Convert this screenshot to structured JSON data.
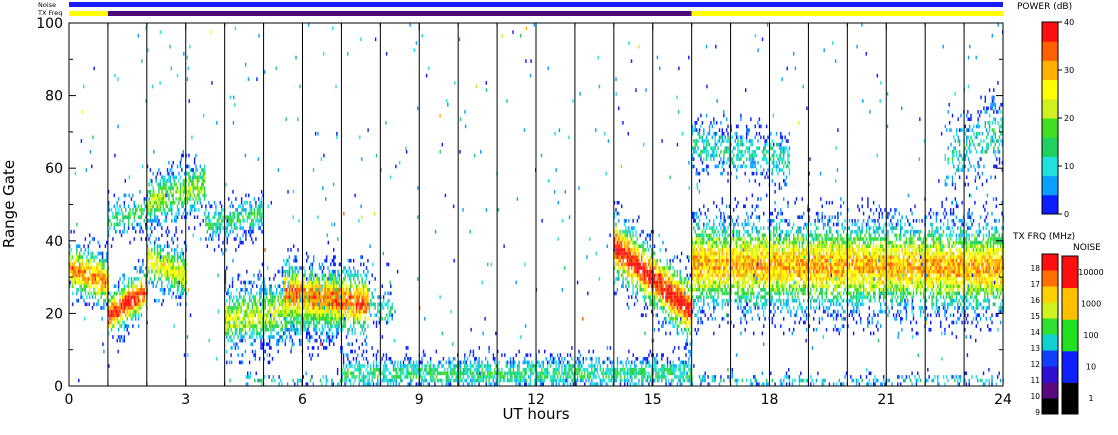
{
  "chart_data": {
    "type": "heatmap",
    "xlabel": "UT hours",
    "ylabel": "Range Gate",
    "xlim": [
      0,
      24
    ],
    "ylim": [
      0,
      100
    ],
    "xticks": [
      0,
      3,
      6,
      9,
      12,
      15,
      18,
      21,
      24
    ],
    "yticks": [
      0,
      20,
      40,
      60,
      80,
      100
    ],
    "scan_boundaries_ut": [
      1,
      2,
      3,
      4,
      5,
      6,
      7,
      8,
      9,
      10,
      11,
      12,
      13,
      14,
      15,
      16,
      17,
      18,
      19,
      20,
      21,
      22,
      23
    ],
    "status_bars": {
      "noise_label": "Noise",
      "txfreq_label": "TX Freq",
      "noise_color": "#1a1aff",
      "txfreq_segments": [
        {
          "start": 0,
          "end": 1,
          "color": "#ffff00"
        },
        {
          "start": 1,
          "end": 16,
          "color": "#4b0b7a"
        },
        {
          "start": 16,
          "end": 24,
          "color": "#ffff00"
        }
      ]
    },
    "power_scale": {
      "title": "POWER (dB)",
      "min": 0,
      "max": 40,
      "ticks": [
        0,
        10,
        20,
        30,
        40
      ],
      "colors": [
        "#0a1eff",
        "#0aa0ff",
        "#20e0e0",
        "#20d060",
        "#40e020",
        "#d0f020",
        "#ffff00",
        "#ffb000",
        "#ff6000",
        "#ff1010"
      ]
    },
    "txfreq_scale": {
      "title": "TX FRQ (MHz)",
      "ticks": [
        9,
        10,
        11,
        12,
        13,
        14,
        15,
        16,
        17,
        18
      ],
      "colors": [
        "#000000",
        "#5a0a80",
        "#3010d0",
        "#1040ff",
        "#10d0d0",
        "#30e030",
        "#d0f020",
        "#ffd000",
        "#ff7000",
        "#ff1010"
      ]
    },
    "noise_scale": {
      "title": "NOISE",
      "ticks": [
        "1",
        "10",
        "100",
        "1000",
        "10000"
      ],
      "colors": [
        "#000000",
        "#1020ff",
        "#20e020",
        "#ffc000",
        "#ff1010"
      ]
    },
    "echo_regions": [
      {
        "t0": 0.0,
        "t1": 1.0,
        "g_center": [
          32,
          28
        ],
        "width": 8,
        "peak": 0.8,
        "density": 0.95
      },
      {
        "t0": 1.0,
        "t1": 2.0,
        "g_center": [
          19,
          26
        ],
        "width": 7,
        "peak": 0.95,
        "density": 0.95
      },
      {
        "t0": 1.0,
        "t1": 2.0,
        "g_center": [
          45,
          48
        ],
        "width": 6,
        "peak": 0.35,
        "density": 0.55
      },
      {
        "t0": 2.0,
        "t1": 3.0,
        "g_center": [
          34,
          30
        ],
        "width": 8,
        "peak": 0.6,
        "density": 0.9
      },
      {
        "t0": 2.0,
        "t1": 3.5,
        "g_center": [
          50,
          55
        ],
        "width": 8,
        "peak": 0.5,
        "density": 0.75
      },
      {
        "t0": 3.5,
        "t1": 5.0,
        "g_center": [
          44,
          47
        ],
        "width": 6,
        "peak": 0.35,
        "density": 0.7
      },
      {
        "t0": 4.0,
        "t1": 7.0,
        "g_center": [
          18,
          22
        ],
        "width": 10,
        "peak": 0.55,
        "density": 0.8
      },
      {
        "t0": 5.5,
        "t1": 7.7,
        "g_center": [
          25,
          22
        ],
        "width": 10,
        "peak": 0.85,
        "density": 0.9
      },
      {
        "t0": 7.7,
        "t1": 8.3,
        "g_center": [
          22,
          20
        ],
        "width": 6,
        "peak": 0.35,
        "density": 0.5
      },
      {
        "t0": 14.0,
        "t1": 16.0,
        "g_center": [
          38,
          20
        ],
        "width": 10,
        "peak": 0.95,
        "density": 0.95
      },
      {
        "t0": 16.0,
        "t1": 24.0,
        "g_center": [
          33,
          32
        ],
        "width": 14,
        "peak": 0.75,
        "density": 0.95
      },
      {
        "t0": 16.0,
        "t1": 18.5,
        "g_center": [
          66,
          62
        ],
        "width": 8,
        "peak": 0.3,
        "density": 0.5
      },
      {
        "t0": 22.5,
        "t1": 24.0,
        "g_center": [
          62,
          70
        ],
        "width": 10,
        "peak": 0.3,
        "density": 0.45
      },
      {
        "t0": 7.0,
        "t1": 16.0,
        "g_center": [
          3,
          3
        ],
        "width": 5,
        "peak": 0.35,
        "density": 0.75
      },
      {
        "t0": 4.5,
        "t1": 7.0,
        "g_center": [
          1,
          1
        ],
        "width": 2,
        "peak": 0.25,
        "density": 0.3
      },
      {
        "t0": 16.0,
        "t1": 24.0,
        "g_center": [
          1,
          1
        ],
        "width": 2,
        "peak": 0.25,
        "density": 0.35
      }
    ]
  }
}
